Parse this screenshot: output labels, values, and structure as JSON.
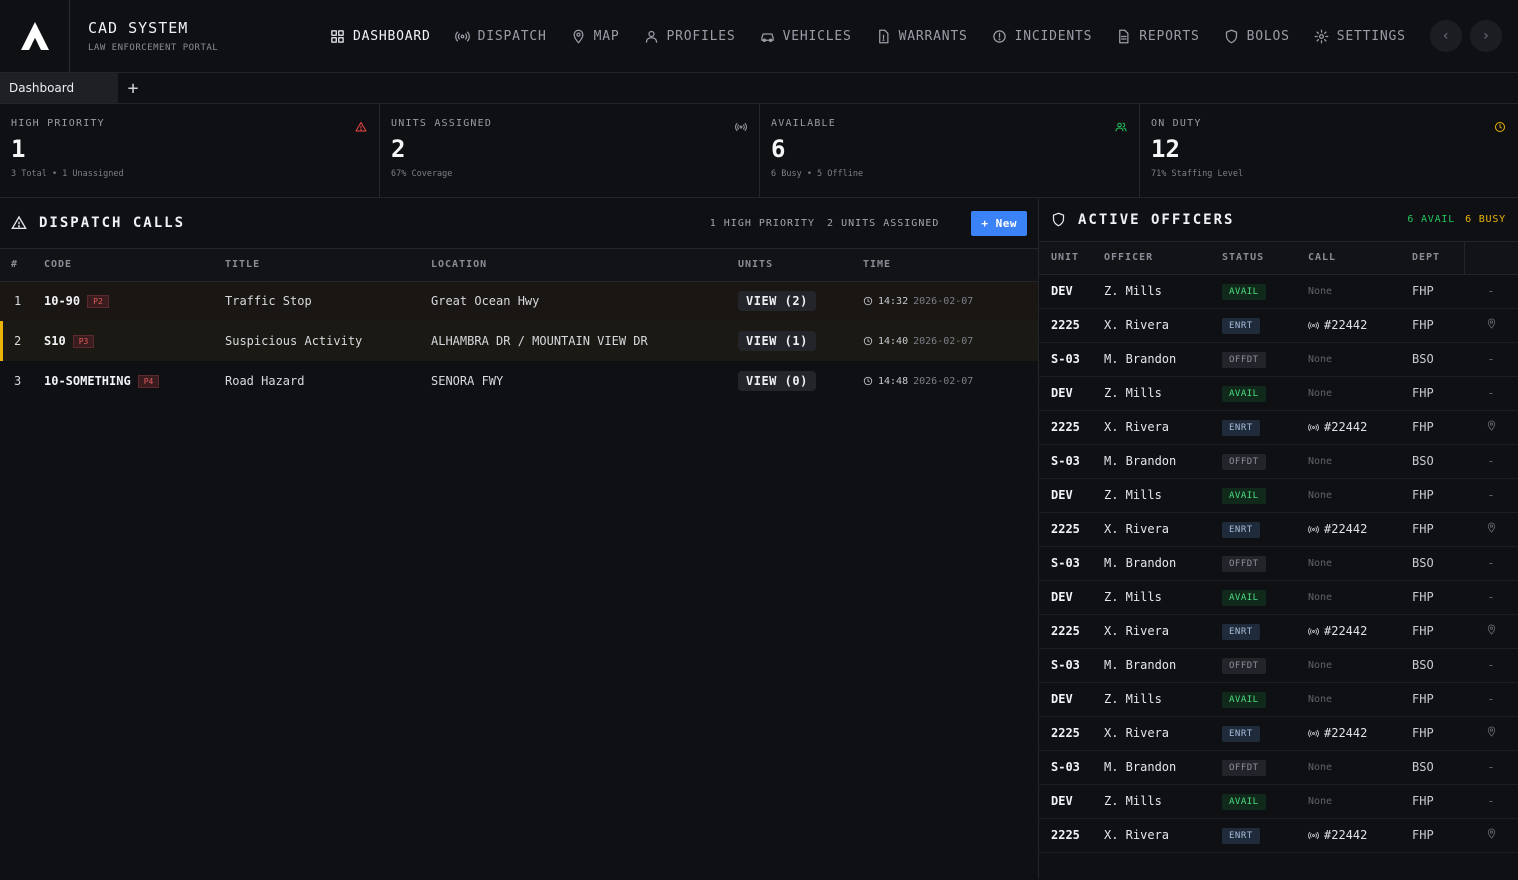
{
  "app": {
    "title": "CAD SYSTEM",
    "subtitle": "LAW ENFORCEMENT PORTAL"
  },
  "nav": [
    {
      "label": "DASHBOARD",
      "icon": "grid-icon",
      "active": true
    },
    {
      "label": "DISPATCH",
      "icon": "radio-icon"
    },
    {
      "label": "MAP",
      "icon": "map-pin-icon"
    },
    {
      "label": "PROFILES",
      "icon": "user-icon"
    },
    {
      "label": "VEHICLES",
      "icon": "car-icon"
    },
    {
      "label": "WARRANTS",
      "icon": "file-alert-icon"
    },
    {
      "label": "INCIDENTS",
      "icon": "alert-circle-icon"
    },
    {
      "label": "REPORTS",
      "icon": "document-icon"
    },
    {
      "label": "BOLOS",
      "icon": "shield-icon"
    },
    {
      "label": "SETTINGS",
      "icon": "gear-icon"
    }
  ],
  "tabs": {
    "active": "Dashboard",
    "add": "+"
  },
  "stats": [
    {
      "label": "HIGH PRIORITY",
      "value": "1",
      "sub": "3 Total • 1 Unassigned",
      "icon": "warning-icon",
      "color": "#ef4444"
    },
    {
      "label": "UNITS ASSIGNED",
      "value": "2",
      "sub": "67% Coverage",
      "icon": "radio-icon",
      "color": "#9a9da6"
    },
    {
      "label": "AVAILABLE",
      "value": "6",
      "sub": "6 Busy • 5 Offline",
      "icon": "users-icon",
      "color": "#22c55e"
    },
    {
      "label": "ON DUTY",
      "value": "12",
      "sub": "71% Staffing Level",
      "icon": "clock-icon",
      "color": "#eab308"
    }
  ],
  "dispatch": {
    "title": "DISPATCH CALLS",
    "meta_priority": "1 HIGH PRIORITY",
    "meta_units": "2 UNITS ASSIGNED",
    "new_label": "New",
    "headers": {
      "num": "#",
      "code": "CODE",
      "title": "TITLE",
      "location": "LOCATION",
      "units": "UNITS",
      "time": "TIME"
    },
    "calls": [
      {
        "num": "1",
        "code": "10-90",
        "priority": "P2",
        "title": "Traffic Stop",
        "location": "Great Ocean Hwy",
        "units": "VIEW (2)",
        "time": "14:32",
        "date": "2026-02-07"
      },
      {
        "num": "2",
        "code": "S10",
        "priority": "P3",
        "title": "Suspicious Activity",
        "location": "ALHAMBRA DR / MOUNTAIN VIEW DR",
        "units": "VIEW (1)",
        "time": "14:40",
        "date": "2026-02-07"
      },
      {
        "num": "3",
        "code": "10-SOMETHING",
        "priority": "P4",
        "title": "Road Hazard",
        "location": "SENORA FWY",
        "units": "VIEW (0)",
        "time": "14:48",
        "date": "2026-02-07"
      }
    ]
  },
  "officers": {
    "title": "ACTIVE OFFICERS",
    "avail": "6 AVAIL",
    "busy": "6 BUSY",
    "headers": {
      "unit": "UNIT",
      "officer": "OFFICER",
      "status": "STATUS",
      "call": "CALL",
      "dept": "DEPT"
    },
    "rows": [
      {
        "unit": "DEV",
        "officer": "Z. Mills",
        "status": "AVAIL",
        "call": "None",
        "dept": "FHP",
        "action": "-"
      },
      {
        "unit": "2225",
        "officer": "X. Rivera",
        "status": "ENRT",
        "call": "#22442",
        "dept": "FHP",
        "action": "pin"
      },
      {
        "unit": "S-03",
        "officer": "M. Brandon",
        "status": "OFFDT",
        "call": "None",
        "dept": "BSO",
        "action": "-"
      },
      {
        "unit": "DEV",
        "officer": "Z. Mills",
        "status": "AVAIL",
        "call": "None",
        "dept": "FHP",
        "action": "-"
      },
      {
        "unit": "2225",
        "officer": "X. Rivera",
        "status": "ENRT",
        "call": "#22442",
        "dept": "FHP",
        "action": "pin"
      },
      {
        "unit": "S-03",
        "officer": "M. Brandon",
        "status": "OFFDT",
        "call": "None",
        "dept": "BSO",
        "action": "-"
      },
      {
        "unit": "DEV",
        "officer": "Z. Mills",
        "status": "AVAIL",
        "call": "None",
        "dept": "FHP",
        "action": "-"
      },
      {
        "unit": "2225",
        "officer": "X. Rivera",
        "status": "ENRT",
        "call": "#22442",
        "dept": "FHP",
        "action": "pin"
      },
      {
        "unit": "S-03",
        "officer": "M. Brandon",
        "status": "OFFDT",
        "call": "None",
        "dept": "BSO",
        "action": "-"
      },
      {
        "unit": "DEV",
        "officer": "Z. Mills",
        "status": "AVAIL",
        "call": "None",
        "dept": "FHP",
        "action": "-"
      },
      {
        "unit": "2225",
        "officer": "X. Rivera",
        "status": "ENRT",
        "call": "#22442",
        "dept": "FHP",
        "action": "pin"
      },
      {
        "unit": "S-03",
        "officer": "M. Brandon",
        "status": "OFFDT",
        "call": "None",
        "dept": "BSO",
        "action": "-"
      },
      {
        "unit": "DEV",
        "officer": "Z. Mills",
        "status": "AVAIL",
        "call": "None",
        "dept": "FHP",
        "action": "-"
      },
      {
        "unit": "2225",
        "officer": "X. Rivera",
        "status": "ENRT",
        "call": "#22442",
        "dept": "FHP",
        "action": "pin"
      },
      {
        "unit": "S-03",
        "officer": "M. Brandon",
        "status": "OFFDT",
        "call": "None",
        "dept": "BSO",
        "action": "-"
      },
      {
        "unit": "DEV",
        "officer": "Z. Mills",
        "status": "AVAIL",
        "call": "None",
        "dept": "FHP",
        "action": "-"
      },
      {
        "unit": "2225",
        "officer": "X. Rivera",
        "status": "ENRT",
        "call": "#22442",
        "dept": "FHP",
        "action": "pin"
      }
    ]
  }
}
